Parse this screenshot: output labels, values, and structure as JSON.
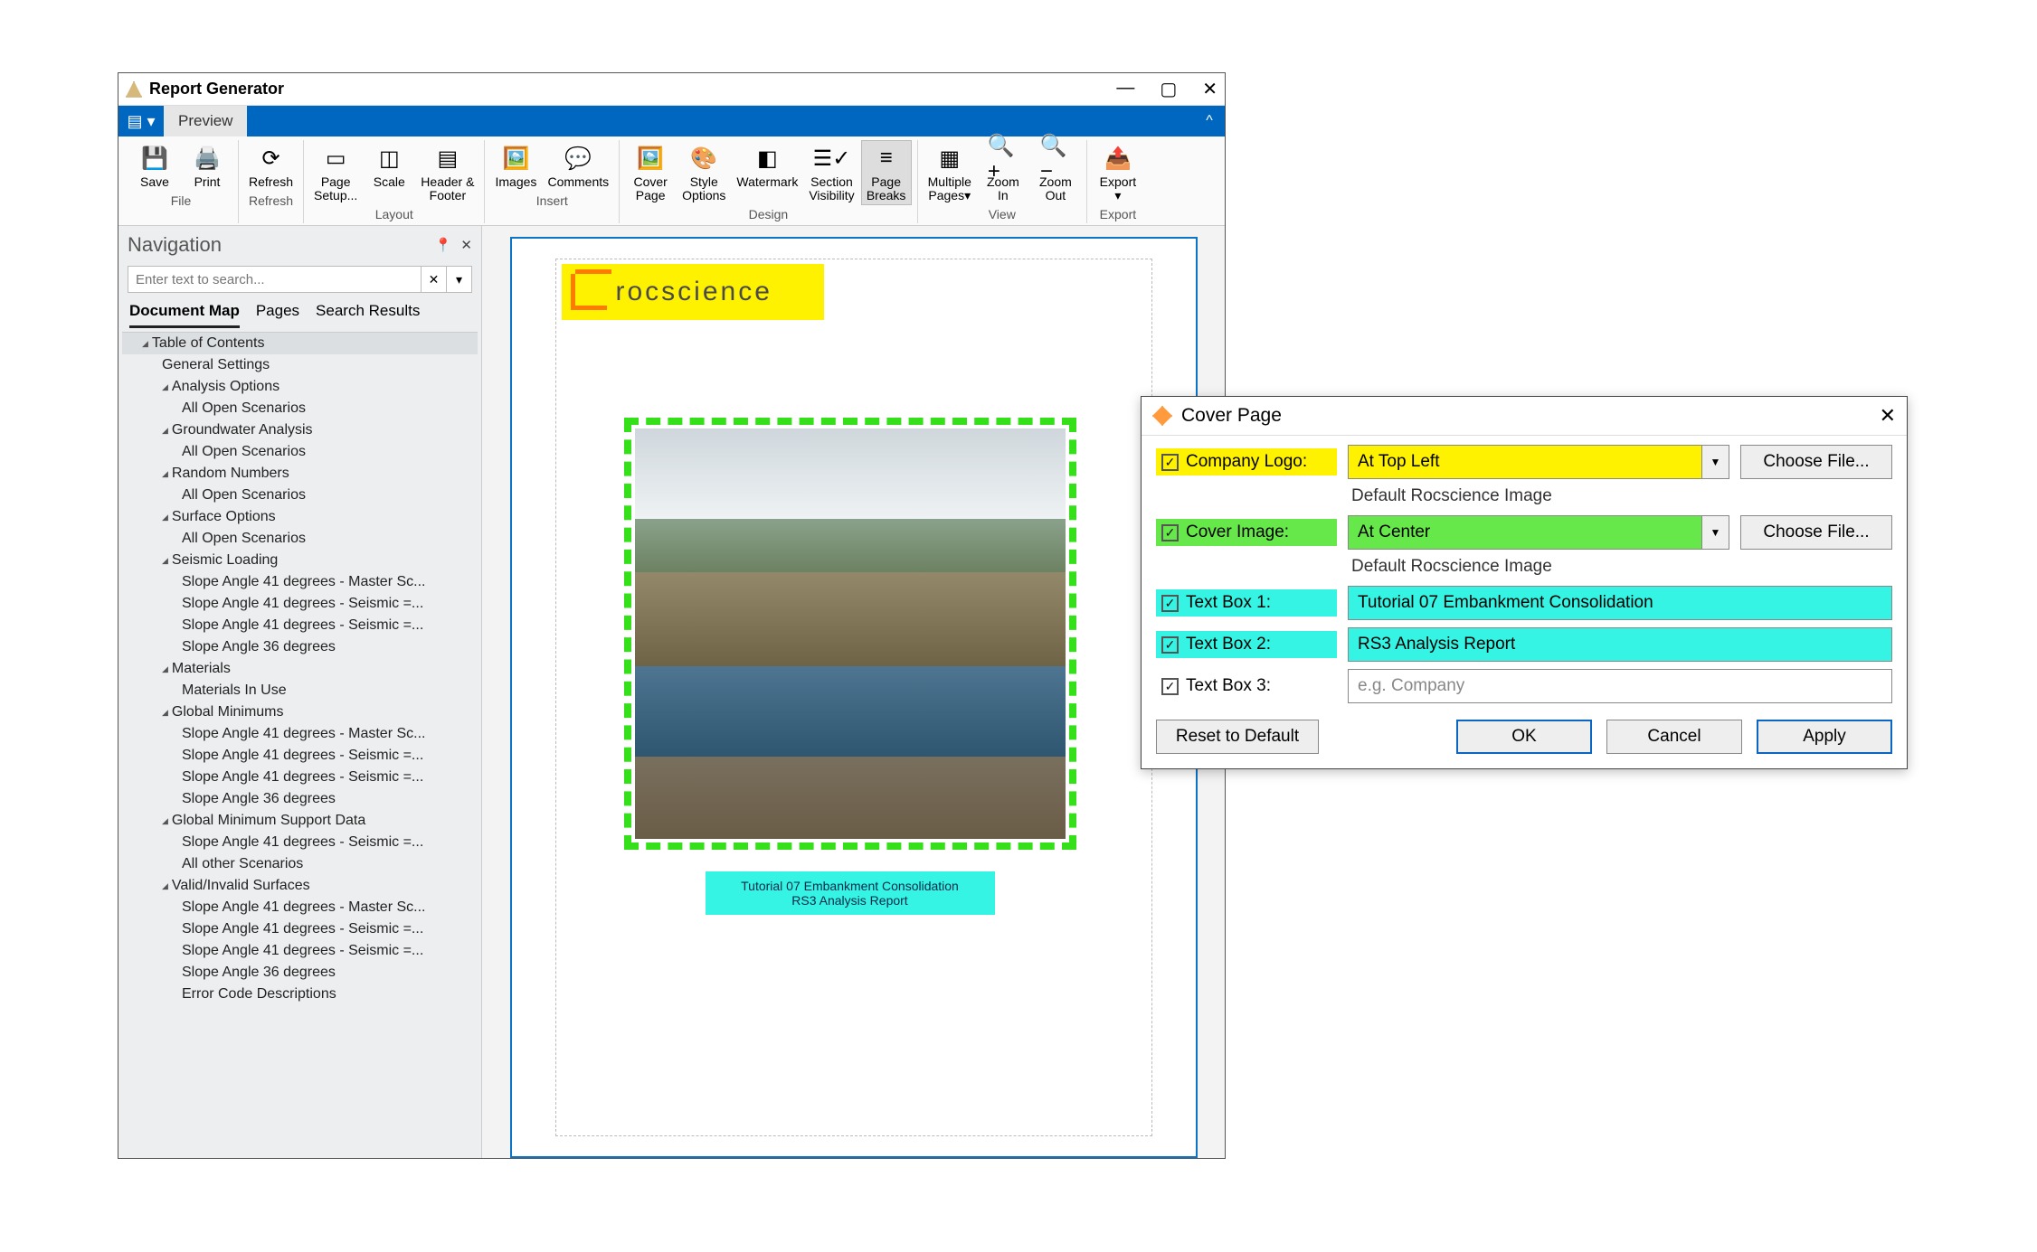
{
  "window": {
    "title": "Report Generator",
    "controls": {
      "minimize": "—",
      "maximize": "▢",
      "close": "✕"
    }
  },
  "menubar": {
    "tab_preview": "Preview"
  },
  "ribbon": {
    "groups": {
      "file": {
        "label": "File",
        "items": {
          "save": "Save",
          "print": "Print"
        }
      },
      "refresh": {
        "label": "Refresh",
        "items": {
          "refresh": "Refresh"
        }
      },
      "layout": {
        "label": "Layout",
        "items": {
          "page_setup": "Page\nSetup...",
          "scale": "Scale",
          "header_footer": "Header &\nFooter"
        }
      },
      "insert": {
        "label": "Insert",
        "items": {
          "images": "Images",
          "comments": "Comments"
        }
      },
      "design": {
        "label": "Design",
        "items": {
          "cover_page": "Cover\nPage",
          "style_options": "Style\nOptions",
          "watermark": "Watermark",
          "section_visibility": "Section\nVisibility",
          "page_breaks": "Page\nBreaks"
        }
      },
      "view": {
        "label": "View",
        "items": {
          "multiple_pages": "Multiple\nPages▾",
          "zoom_in": "Zoom\nIn",
          "zoom_out": "Zoom\nOut"
        }
      },
      "export": {
        "label": "Export",
        "items": {
          "export": "Export\n▾"
        }
      }
    }
  },
  "nav": {
    "title": "Navigation",
    "search_placeholder": "Enter text to search...",
    "tabs": {
      "doc_map": "Document Map",
      "pages": "Pages",
      "search": "Search Results"
    },
    "tree": [
      {
        "t": "Table of Contents",
        "lvl": 1,
        "caret": true,
        "hdr": true
      },
      {
        "t": "General Settings",
        "lvl": 2
      },
      {
        "t": "Analysis Options",
        "lvl": 2,
        "caret": true
      },
      {
        "t": "All Open Scenarios",
        "lvl": 3
      },
      {
        "t": "Groundwater Analysis",
        "lvl": 2,
        "caret": true
      },
      {
        "t": "All Open Scenarios",
        "lvl": 3
      },
      {
        "t": "Random Numbers",
        "lvl": 2,
        "caret": true
      },
      {
        "t": "All Open Scenarios",
        "lvl": 3
      },
      {
        "t": "Surface Options",
        "lvl": 2,
        "caret": true
      },
      {
        "t": "All Open Scenarios",
        "lvl": 3
      },
      {
        "t": "Seismic Loading",
        "lvl": 2,
        "caret": true
      },
      {
        "t": "Slope Angle 41 degrees - Master Sc...",
        "lvl": 3
      },
      {
        "t": "Slope Angle 41 degrees - Seismic =...",
        "lvl": 3
      },
      {
        "t": "Slope Angle 41 degrees - Seismic =...",
        "lvl": 3
      },
      {
        "t": "Slope Angle 36 degrees",
        "lvl": 3
      },
      {
        "t": "Materials",
        "lvl": 2,
        "caret": true
      },
      {
        "t": "Materials In Use",
        "lvl": 3
      },
      {
        "t": "Global Minimums",
        "lvl": 2,
        "caret": true
      },
      {
        "t": "Slope Angle 41 degrees - Master Sc...",
        "lvl": 3
      },
      {
        "t": "Slope Angle 41 degrees - Seismic =...",
        "lvl": 3
      },
      {
        "t": "Slope Angle 41 degrees - Seismic =...",
        "lvl": 3
      },
      {
        "t": "Slope Angle 36 degrees",
        "lvl": 3
      },
      {
        "t": "Global Minimum Support Data",
        "lvl": 2,
        "caret": true
      },
      {
        "t": "Slope Angle 41 degrees - Seismic =...",
        "lvl": 3
      },
      {
        "t": "All other Scenarios",
        "lvl": 3
      },
      {
        "t": "Valid/Invalid Surfaces",
        "lvl": 2,
        "caret": true
      },
      {
        "t": "Slope Angle 41 degrees - Master Sc...",
        "lvl": 3
      },
      {
        "t": "Slope Angle 41 degrees - Seismic =...",
        "lvl": 3
      },
      {
        "t": "Slope Angle 41 degrees - Seismic =...",
        "lvl": 3
      },
      {
        "t": "Slope Angle 36 degrees",
        "lvl": 3
      },
      {
        "t": "Error Code Descriptions",
        "lvl": 3
      }
    ]
  },
  "preview": {
    "logo_text": "rocscience",
    "title_line1": "Tutorial 07 Embankment Consolidation",
    "title_line2": "RS3 Analysis Report"
  },
  "dialog": {
    "title": "Cover Page",
    "rows": {
      "logo": {
        "label": "Company Logo:",
        "value": "At Top Left",
        "button": "Choose File...",
        "hint": "Default Rocscience Image"
      },
      "image": {
        "label": "Cover Image:",
        "value": "At Center",
        "button": "Choose File...",
        "hint": "Default Rocscience Image"
      },
      "tb1": {
        "label": "Text Box 1:",
        "value": "Tutorial 07 Embankment Consolidation"
      },
      "tb2": {
        "label": "Text Box 2:",
        "value": "RS3 Analysis Report"
      },
      "tb3": {
        "label": "Text Box 3:",
        "placeholder": "e.g. Company"
      }
    },
    "buttons": {
      "reset": "Reset to Default",
      "ok": "OK",
      "cancel": "Cancel",
      "apply": "Apply"
    }
  }
}
